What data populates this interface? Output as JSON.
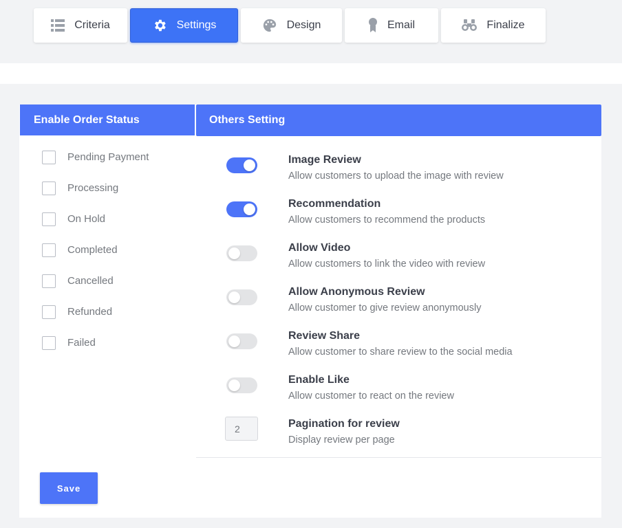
{
  "tabs": [
    {
      "label": "Criteria",
      "icon": "list-icon"
    },
    {
      "label": "Settings",
      "icon": "gear-icon",
      "active": true
    },
    {
      "label": "Design",
      "icon": "palette-icon"
    },
    {
      "label": "Email",
      "icon": "award-ribbon-icon"
    },
    {
      "label": "Finalize",
      "icon": "binoculars-icon"
    }
  ],
  "order_status": {
    "title": "Enable Order Status",
    "items": [
      {
        "label": "Pending Payment",
        "checked": false
      },
      {
        "label": "Processing",
        "checked": false
      },
      {
        "label": "On Hold",
        "checked": false
      },
      {
        "label": "Completed",
        "checked": false
      },
      {
        "label": "Cancelled",
        "checked": false
      },
      {
        "label": "Refunded",
        "checked": false
      },
      {
        "label": "Failed",
        "checked": false
      }
    ]
  },
  "others": {
    "title": "Others Setting",
    "settings": [
      {
        "title": "Image Review",
        "desc": "Allow customers to upload the image with review",
        "enabled": true
      },
      {
        "title": "Recommendation",
        "desc": "Allow customers to recommend the products",
        "enabled": true
      },
      {
        "title": "Allow Video",
        "desc": "Allow customers to link the video with review",
        "enabled": false
      },
      {
        "title": "Allow Anonymous Review",
        "desc": "Allow customer to give review anonymously",
        "enabled": false
      },
      {
        "title": "Review Share",
        "desc": "Allow customer to share review to the social media",
        "enabled": false
      },
      {
        "title": "Enable Like",
        "desc": "Allow customer to react on the review",
        "enabled": false
      }
    ],
    "pagination": {
      "title": "Pagination for review",
      "desc": "Display review per page",
      "value": "2"
    }
  },
  "save_label": "Save",
  "colors": {
    "accent": "#4d74f8",
    "tab_active": "#3d73f6",
    "toggle_off": "#e3e4e6"
  }
}
